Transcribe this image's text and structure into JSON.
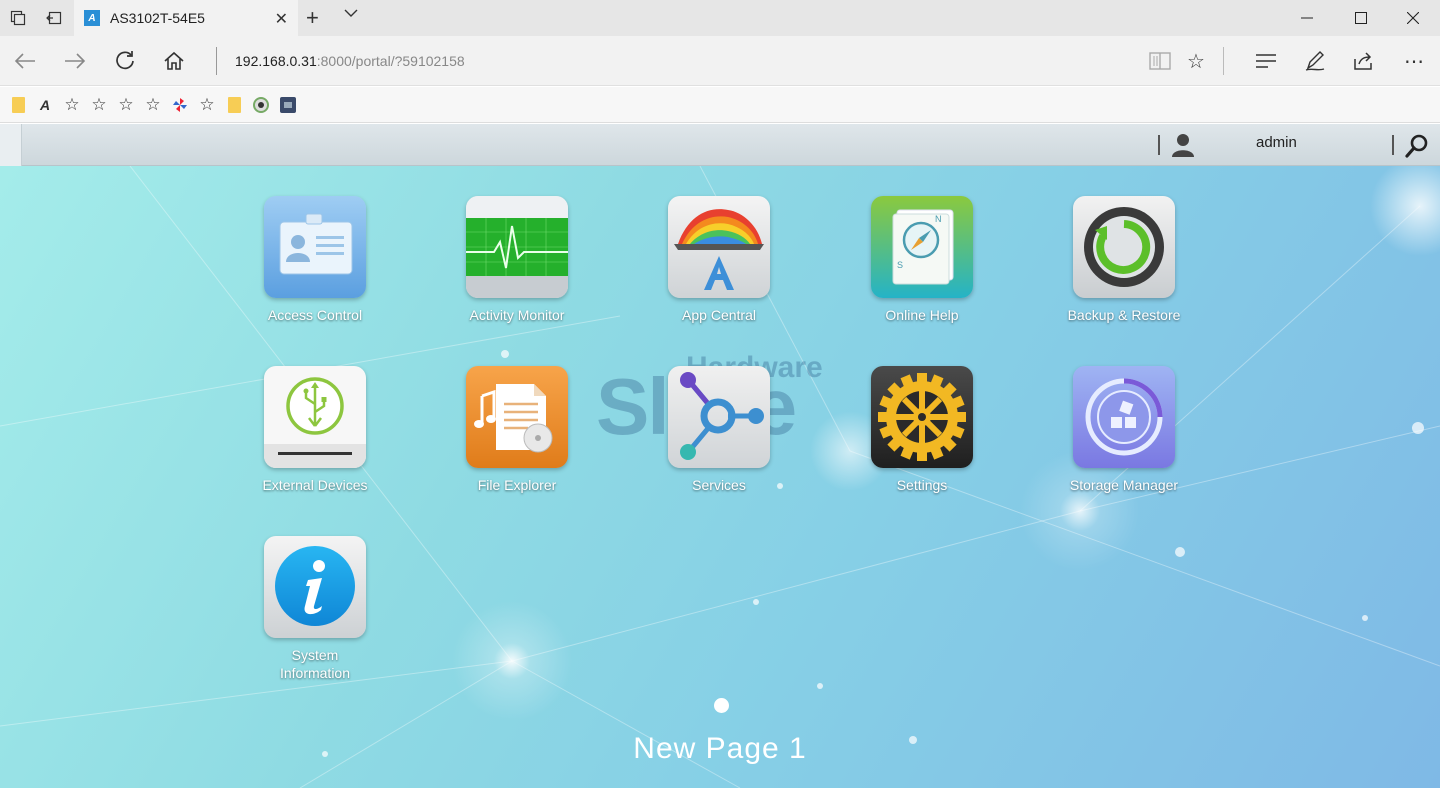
{
  "browser": {
    "tab": {
      "title": "AS3102T-54E5",
      "favicon_letter": "A"
    },
    "url": {
      "host": "192.168.0.31",
      "rest": ":8000/portal/?59102158"
    }
  },
  "header": {
    "username": "admin"
  },
  "apps": [
    {
      "label": "Access Control"
    },
    {
      "label": "Activity Monitor"
    },
    {
      "label": "App Central"
    },
    {
      "label": "Online Help"
    },
    {
      "label": "Backup & Restore"
    },
    {
      "label": "External Devices"
    },
    {
      "label": "File Explorer"
    },
    {
      "label": "Services"
    },
    {
      "label": "Settings"
    },
    {
      "label": "Storage Manager"
    },
    {
      "label_line1": "System",
      "label_line2": "Information"
    }
  ],
  "watermark": {
    "top": "Hardware",
    "main": "Slave"
  },
  "pager": {
    "label": "New Page 1"
  },
  "colors": {
    "desktop_start": "#a4ecea",
    "desktop_end": "#7fb9e6",
    "accent": "#2a8fd6"
  }
}
